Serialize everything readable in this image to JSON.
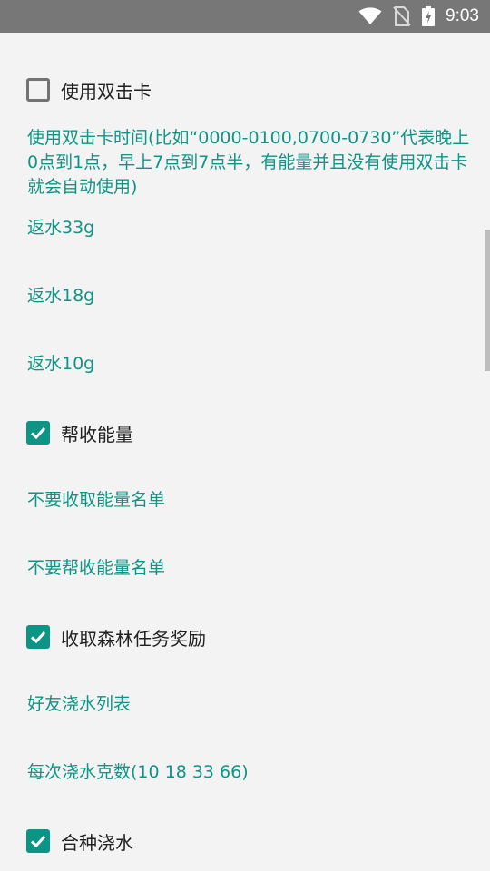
{
  "status": {
    "time": "9:03"
  },
  "settings": {
    "double_click_card": {
      "label": "使用双击卡",
      "checked": false
    },
    "double_click_time": "使用双击卡时间(比如“0000-0100,0700-0730”代表晚上0点到1点，早上7点到7点半，有能量并且没有使用双击卡就会自动使用)",
    "return_water_33": "返水33g",
    "return_water_18": "返水18g",
    "return_water_10": "返水10g",
    "help_collect_energy": {
      "label": "帮收能量",
      "checked": true
    },
    "no_collect_list": "不要收取能量名单",
    "no_help_collect_list": "不要帮收能量名单",
    "collect_forest_reward": {
      "label": "收取森林任务奖励",
      "checked": true
    },
    "friend_water_list": "好友浇水列表",
    "water_amounts": "每次浇水克数(10 18 33 66)",
    "cooperate_water": {
      "label": "合种浇水",
      "checked": true
    }
  },
  "colors": {
    "accent": "#0c9484",
    "link": "#0f9585",
    "statusbar": "#777777",
    "background": "#f3f3f3"
  }
}
